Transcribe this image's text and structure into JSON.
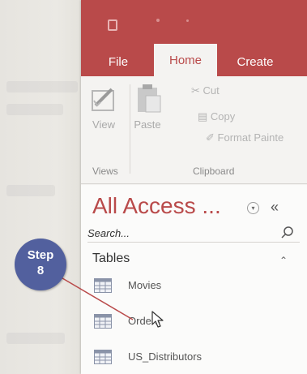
{
  "tabs": {
    "file": "File",
    "home": "Home",
    "create": "Create"
  },
  "ribbon": {
    "view_label": "View",
    "paste_label": "Paste",
    "cut_label": "Cut",
    "copy_label": "Copy",
    "format_painter_label": "Format Painte",
    "views_group": "Views",
    "clipboard_group": "Clipboard"
  },
  "nav": {
    "title": "All Access ...",
    "search_placeholder": "Search...",
    "section": "Tables",
    "items": [
      {
        "label": "Movies"
      },
      {
        "label": "Orders"
      },
      {
        "label": "US_Distributors"
      }
    ]
  },
  "callout": {
    "line1": "Step",
    "line2": "8"
  },
  "colors": {
    "accent": "#b94a4a",
    "callout": "#52609e"
  }
}
